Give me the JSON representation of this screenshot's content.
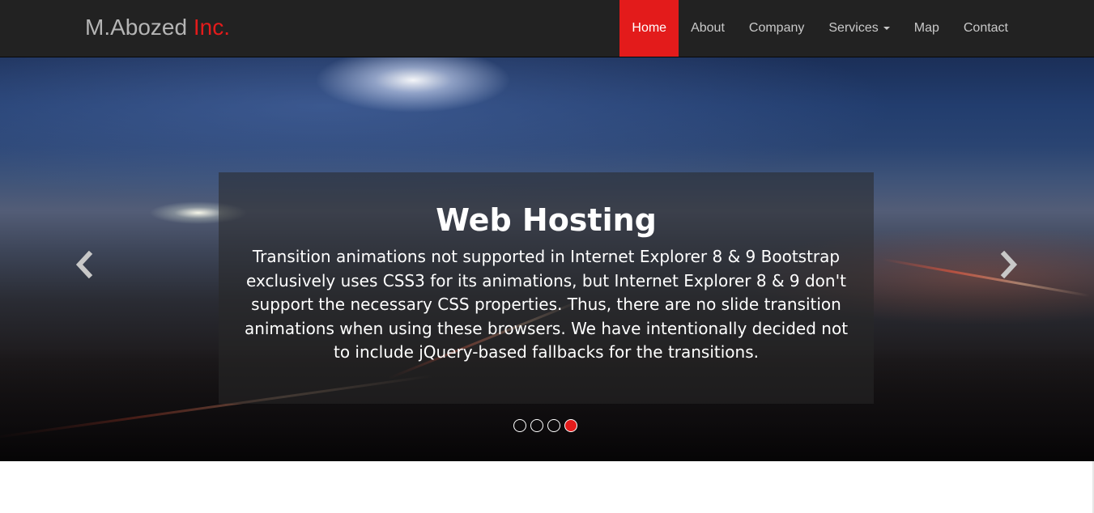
{
  "navbar": {
    "brand_name": "M.Abozed",
    "brand_suffix": "Inc.",
    "items": [
      {
        "label": "Home",
        "active": true
      },
      {
        "label": "About",
        "active": false
      },
      {
        "label": "Company",
        "active": false
      },
      {
        "label": "Services",
        "active": false,
        "dropdown": true
      },
      {
        "label": "Map",
        "active": false
      },
      {
        "label": "Contact",
        "active": false
      }
    ]
  },
  "carousel": {
    "caption_title": "Web Hosting",
    "caption_text": "Transition animations not supported in Internet Explorer 8 & 9 Bootstrap exclusively uses CSS3 for its animations, but Internet Explorer 8 & 9 don't support the necessary CSS properties. Thus, there are no slide transition animations when using these browsers. We have intentionally decided not to include jQuery-based fallbacks for the transitions.",
    "prev_icon": "chevron-left-icon",
    "next_icon": "chevron-right-icon",
    "slide_count": 4,
    "active_slide": 4
  },
  "colors": {
    "accent": "#e31b1b",
    "navbar_bg": "#222222",
    "nav_text": "#c9c9c9",
    "brand_text": "#b5b5b5"
  }
}
